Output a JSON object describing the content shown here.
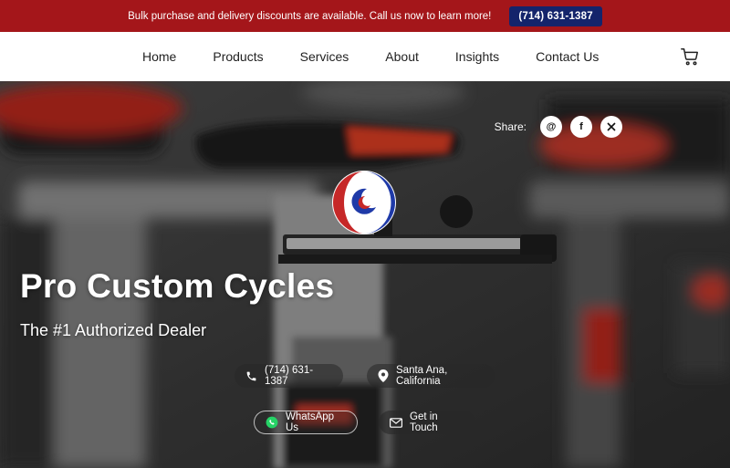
{
  "topbar": {
    "message": "Bulk purchase and delivery discounts are available. Call us now to learn more!",
    "phone_label": "(714) 631-1387"
  },
  "nav": {
    "items": [
      "Home",
      "Products",
      "Services",
      "About",
      "Insights",
      "Contact Us"
    ]
  },
  "hero": {
    "share_label": "Share:",
    "title": "Pro Custom Cycles",
    "subtitle": "The #1 Authorized Dealer",
    "phone": "(714) 631-1387",
    "location": "Santa Ana, California",
    "whatsapp_label": "WhatsApp Us",
    "contact_label": "Get in Touch"
  },
  "colors": {
    "topbar_bg": "#a4161a",
    "phone_btn_bg": "#14246b",
    "logo_red": "#c62828",
    "logo_blue": "#1f3aa8"
  },
  "icons": [
    "cart-icon",
    "email-icon",
    "facebook-icon",
    "x-icon",
    "phone-icon",
    "location-icon",
    "whatsapp-icon",
    "mail-icon"
  ]
}
